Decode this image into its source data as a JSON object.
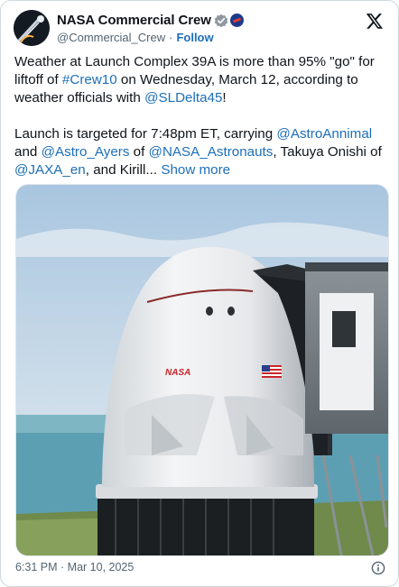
{
  "author": {
    "display_name": "NASA Commercial Crew",
    "handle": "@Commercial_Crew",
    "separator": "·",
    "follow_label": "Follow"
  },
  "icons": {
    "avatar": "avatar-image",
    "verified": "verified-badge-icon",
    "government": "government-affiliation-icon",
    "x_logo": "x-logo-icon",
    "info": "info-icon"
  },
  "tweet": {
    "p1_t1": "Weather at Launch Complex 39A is more than 95% \"go\" for liftoff of ",
    "p1_l1": "#Crew10",
    "p1_t2": " on Wednesday, March 12, according to weather officials with ",
    "p1_l2": "@SLDelta45",
    "p1_t3": "!",
    "p2_t1": "Launch is targeted for 7:48pm ET, carrying ",
    "p2_l1": "@AstroAnnimal",
    "p2_t2": " and ",
    "p2_l2": "@Astro_Ayers",
    "p2_t3": " of ",
    "p2_l3": "@NASA_Astronauts",
    "p2_t4": ", Takuya Onishi of ",
    "p2_l4": "@JAXA_en",
    "p2_t5": ", and Kirill... ",
    "show_more": "Show more"
  },
  "media": {
    "capsule_logo": "NASA"
  },
  "footer": {
    "timestamp": "6:31 PM · Mar 10, 2025"
  },
  "colors": {
    "link": "#1d6fb8",
    "text": "#0f1419",
    "muted": "#536471",
    "verified": "#1d9bf0"
  }
}
